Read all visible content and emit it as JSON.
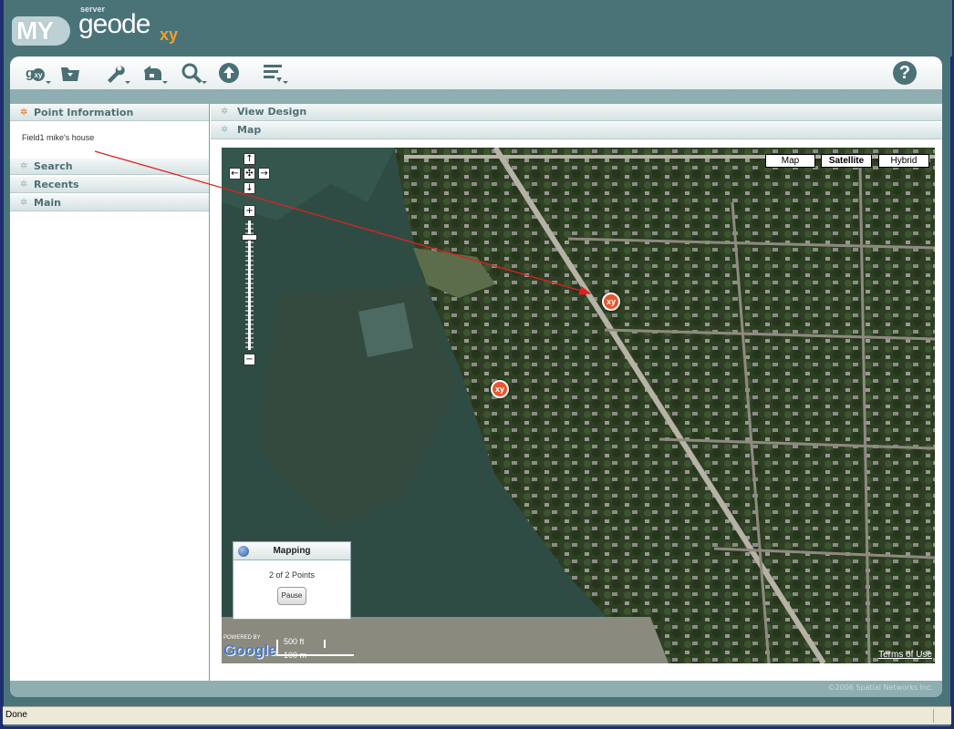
{
  "header": {
    "logo_my": "MY",
    "logo_server": "server",
    "logo_geode": "geode",
    "logo_xy": "xy"
  },
  "toolbar": {
    "tools": [
      {
        "icon": "gxy-icon"
      },
      {
        "icon": "folder-icon"
      },
      {
        "icon": "wrench-icon"
      },
      {
        "icon": "undo-icon"
      },
      {
        "icon": "search-icon"
      },
      {
        "icon": "upload-icon"
      },
      {
        "icon": "list-icon"
      }
    ],
    "help_label": "?"
  },
  "left_panel": {
    "point_info_title": "Point Information",
    "point_info_text": "Field1 mike's house",
    "search": "Search",
    "recents": "Recents",
    "main": "Main"
  },
  "right_panel": {
    "view_design": "View Design",
    "map_title": "Map"
  },
  "map": {
    "types": {
      "map": "Map",
      "satellite": "Satellite",
      "hybrid": "Hybrid"
    },
    "selected_type": "Satellite",
    "marker_label": "xy",
    "mapping": {
      "title": "Mapping",
      "status": "2 of 2 Points",
      "pause": "Pause"
    },
    "google": "Google",
    "powered_by": "POWERED BY",
    "scale_ft": "500 ft",
    "scale_m": "100 m",
    "terms": "Terms of Use",
    "zoom_in": "+",
    "zoom_out": "−"
  },
  "footer": {
    "copyright": "©2006 Spatial Networks Inc."
  },
  "statusbar": {
    "text": "Done"
  },
  "colors": {
    "accent": "#e9572d",
    "chrome": "#4a7378",
    "strip": "#8eaeb2"
  }
}
